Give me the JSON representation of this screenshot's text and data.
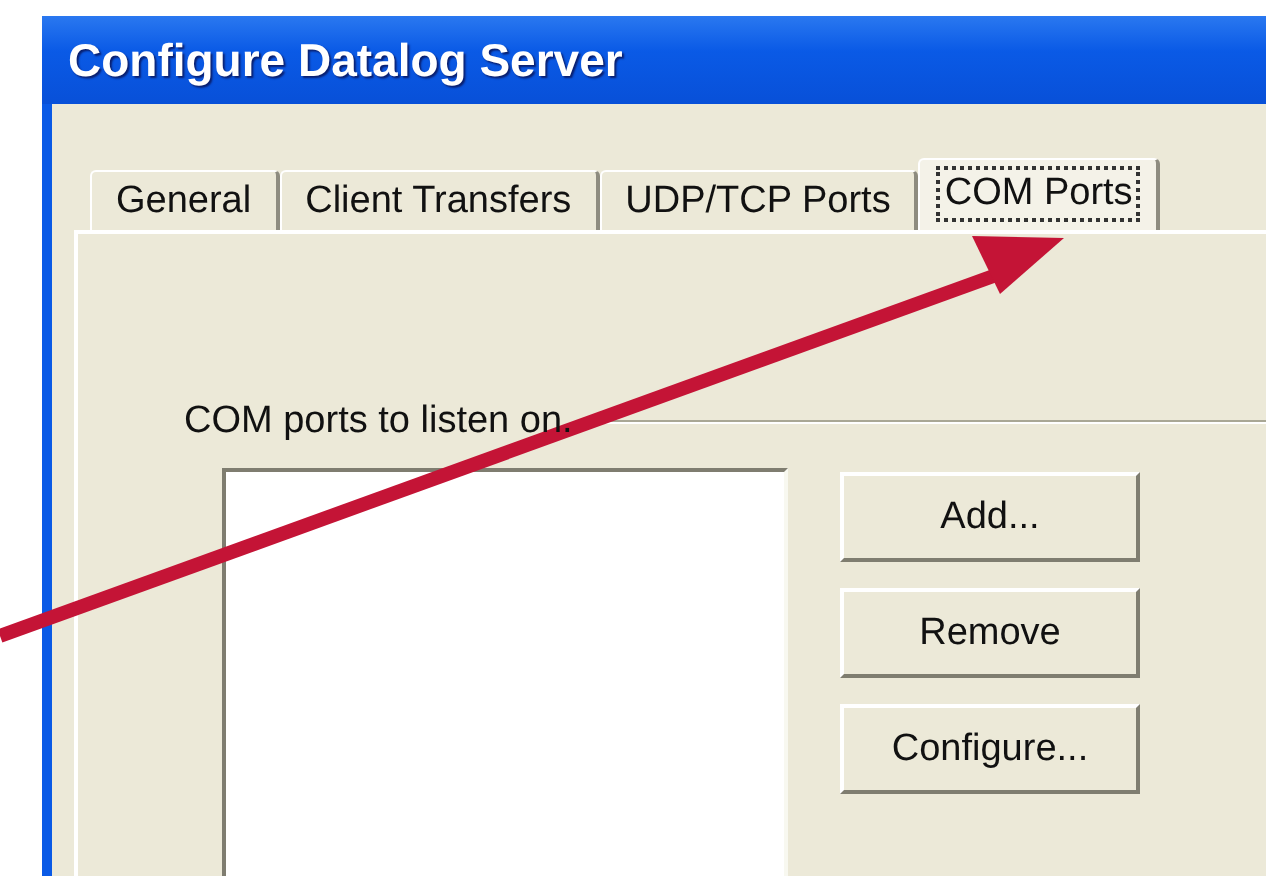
{
  "window": {
    "title": "Configure Datalog Server"
  },
  "tabs": [
    {
      "label": "General",
      "selected": false
    },
    {
      "label": "Client Transfers",
      "selected": false
    },
    {
      "label": "UDP/TCP Ports",
      "selected": false
    },
    {
      "label": "COM Ports",
      "selected": true
    }
  ],
  "group": {
    "label": "COM ports to listen on."
  },
  "buttons": [
    "Add...",
    "Remove",
    "Configure..."
  ]
}
